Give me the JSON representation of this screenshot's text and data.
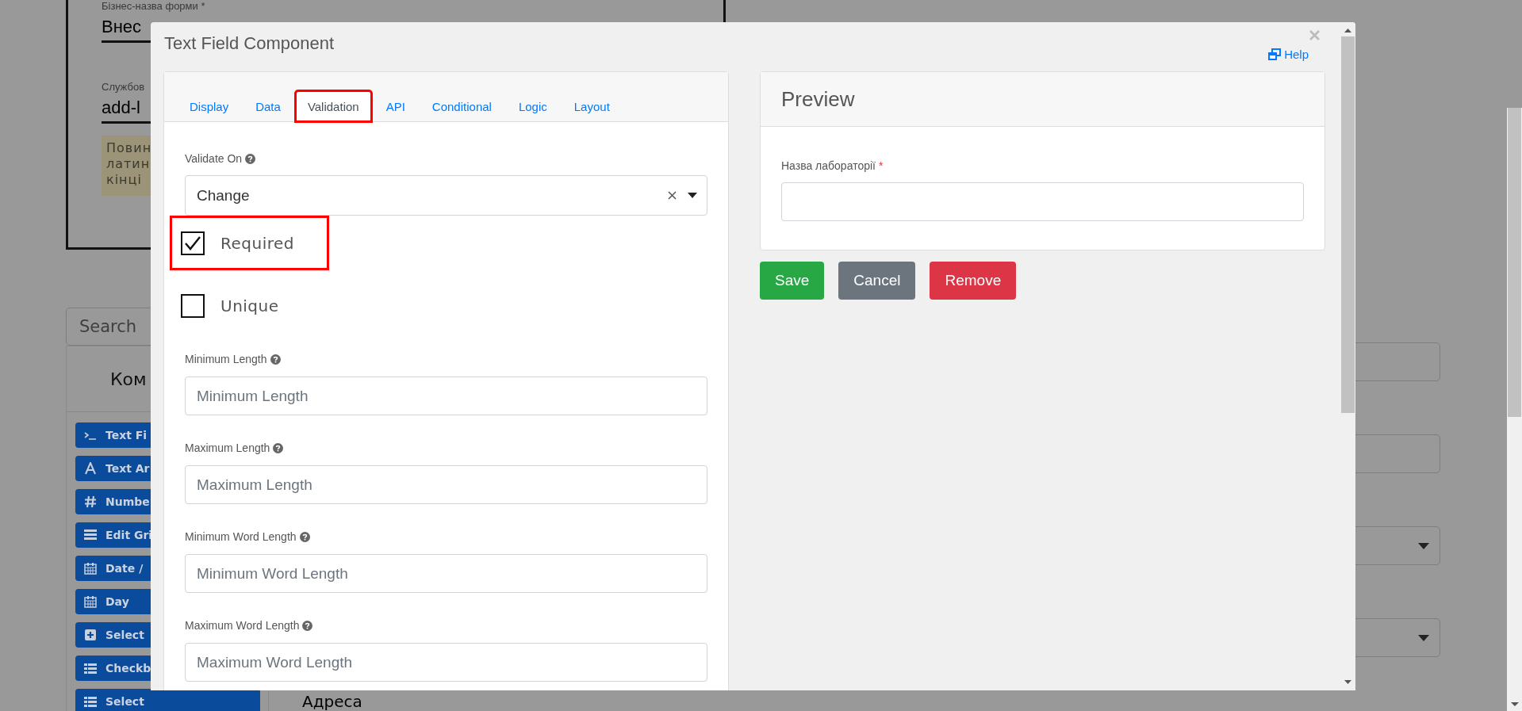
{
  "background": {
    "form": {
      "title_label": "Бізнес-назва форми *",
      "name_value": "Внес",
      "code_label": "Службов",
      "code_value": "add-l",
      "note_lines": [
        "Повин",
        "латин",
        "кінці"
      ]
    },
    "search": {
      "placeholder": "Search"
    },
    "components": {
      "title": "Ком",
      "buttons": [
        {
          "kind": "terminal",
          "label": "Text Fi"
        },
        {
          "kind": "font",
          "label": "Text Ar"
        },
        {
          "kind": "hash",
          "label": "Numbe"
        },
        {
          "kind": "grid",
          "label": "Edit Gri"
        },
        {
          "kind": "calendar",
          "label": "Date /"
        },
        {
          "kind": "calendar",
          "label": "Day"
        },
        {
          "kind": "plus-square",
          "label": "Select"
        },
        {
          "kind": "list",
          "label": "Checkb"
        },
        {
          "kind": "list",
          "label": "Select"
        }
      ]
    },
    "address_label": "Адреса",
    "fields": [
      {
        "kind": "input"
      },
      {
        "kind": "input"
      },
      {
        "kind": "select"
      },
      {
        "kind": "select"
      }
    ]
  },
  "modal": {
    "title": "Text Field Component",
    "help": "Help",
    "tabs": [
      {
        "label": "Display",
        "selected": false,
        "highlighted": false
      },
      {
        "label": "Data",
        "selected": false,
        "highlighted": false
      },
      {
        "label": "Validation",
        "selected": true,
        "highlighted": true
      },
      {
        "label": "API",
        "selected": false,
        "highlighted": false
      },
      {
        "label": "Conditional",
        "selected": false,
        "highlighted": false
      },
      {
        "label": "Logic",
        "selected": false,
        "highlighted": false
      },
      {
        "label": "Layout",
        "selected": false,
        "highlighted": false
      }
    ],
    "validate_on": {
      "label": "Validate On",
      "value": "Change"
    },
    "checkboxes": [
      {
        "label": "Required",
        "checked": true,
        "highlighted": true
      },
      {
        "label": "Unique",
        "checked": false,
        "highlighted": false
      }
    ],
    "fields": [
      {
        "label": "Minimum Length",
        "placeholder": "Minimum Length"
      },
      {
        "label": "Maximum Length",
        "placeholder": "Maximum Length"
      },
      {
        "label": "Minimum Word Length",
        "placeholder": "Minimum Word Length"
      },
      {
        "label": "Maximum Word Length",
        "placeholder": "Maximum Word Length"
      }
    ],
    "preview": {
      "title": "Preview",
      "field_label": "Назва лабораторії",
      "required_mark": "*"
    },
    "buttons": [
      {
        "label": "Save",
        "kind": "success"
      },
      {
        "label": "Cancel",
        "kind": "secondary"
      },
      {
        "label": "Remove",
        "kind": "danger"
      }
    ]
  }
}
